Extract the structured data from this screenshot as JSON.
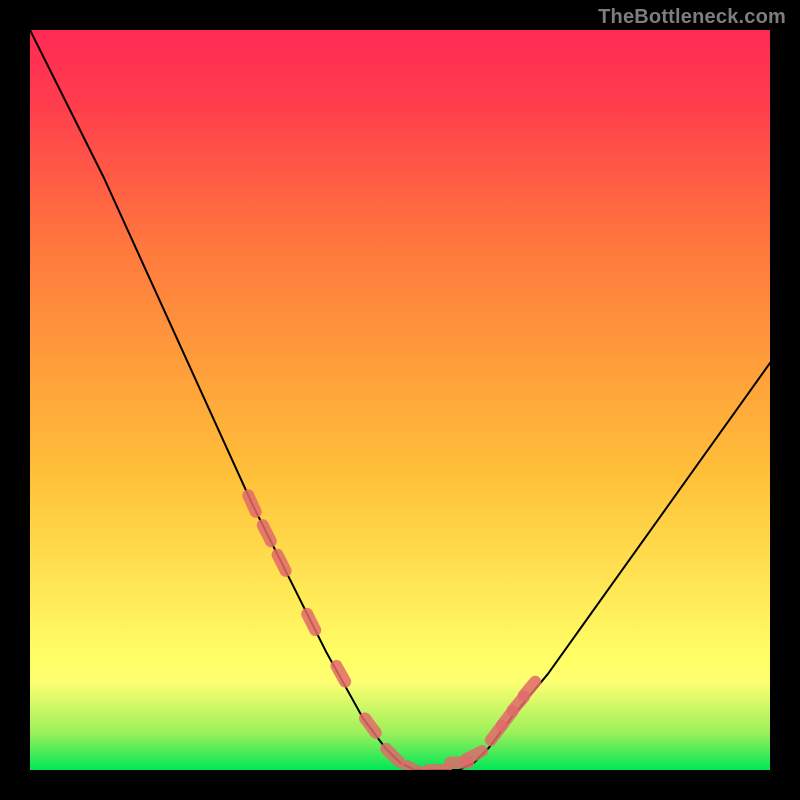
{
  "watermark": "TheBottleneck.com",
  "chart_data": {
    "type": "line",
    "title": "",
    "xlabel": "",
    "ylabel": "",
    "xlim": [
      0,
      100
    ],
    "ylim": [
      0,
      100
    ],
    "grid": false,
    "legend": false,
    "background_gradient": {
      "stops": [
        {
          "offset": 0.0,
          "color": "#00e756"
        },
        {
          "offset": 0.05,
          "color": "#9bf05a"
        },
        {
          "offset": 0.12,
          "color": "#ffff72"
        },
        {
          "offset": 0.15,
          "color": "#ffff66"
        },
        {
          "offset": 0.4,
          "color": "#ffc039"
        },
        {
          "offset": 0.7,
          "color": "#ff7a3d"
        },
        {
          "offset": 0.9,
          "color": "#ff3d4d"
        },
        {
          "offset": 1.0,
          "color": "#ff2a54"
        }
      ]
    },
    "series": [
      {
        "name": "curve",
        "color": "#000000",
        "stroke_width": 2,
        "x": [
          0,
          5,
          10,
          15,
          20,
          25,
          30,
          35,
          40,
          45,
          48,
          50,
          52,
          55,
          58,
          60,
          62,
          65,
          70,
          75,
          80,
          85,
          90,
          95,
          100
        ],
        "y": [
          100,
          90,
          80,
          69,
          58,
          47,
          36,
          26,
          16,
          7,
          3,
          1,
          0,
          0,
          0,
          1,
          3,
          7,
          13,
          20,
          27,
          34,
          41,
          48,
          55
        ]
      },
      {
        "name": "markers",
        "type": "scatter",
        "color": "#e26a6a",
        "marker": "pill",
        "x": [
          30,
          32,
          34,
          38,
          42,
          46,
          49,
          52,
          55,
          58,
          60,
          63,
          64.5,
          66,
          67.5
        ],
        "y": [
          36,
          32,
          28,
          20,
          13,
          6,
          2,
          0,
          0,
          1,
          2,
          5,
          7,
          9,
          11
        ]
      }
    ]
  }
}
